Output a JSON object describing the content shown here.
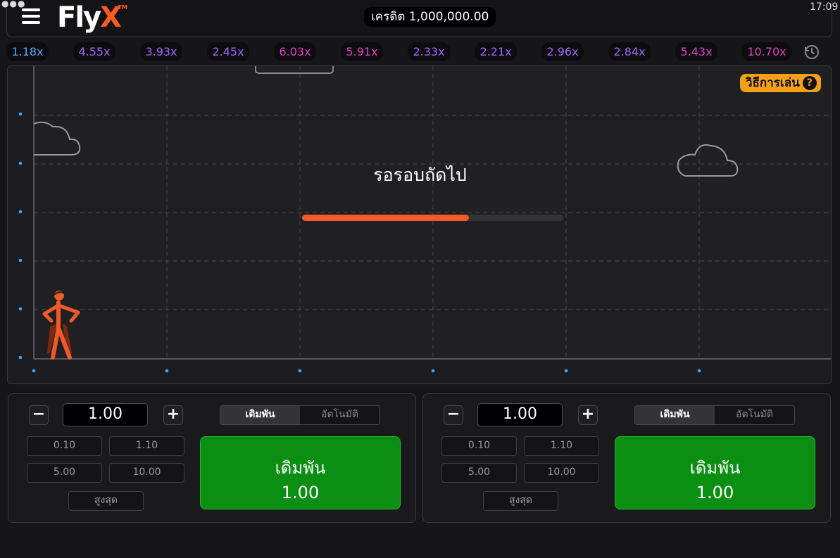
{
  "header": {
    "logo_main": "Fly",
    "logo_accent": "X",
    "logo_tm": "TM",
    "credit_label": "เครดิต 1,000,000.00",
    "clock": "17:09"
  },
  "history": {
    "items": [
      {
        "value": "1.18x",
        "color": "#4fa8ff"
      },
      {
        "value": "4.55x",
        "color": "#a066ff"
      },
      {
        "value": "3.93x",
        "color": "#a066ff"
      },
      {
        "value": "2.45x",
        "color": "#a066ff"
      },
      {
        "value": "6.03x",
        "color": "#e040c0"
      },
      {
        "value": "5.91x",
        "color": "#e040c0"
      },
      {
        "value": "2.33x",
        "color": "#a066ff"
      },
      {
        "value": "2.21x",
        "color": "#a066ff"
      },
      {
        "value": "2.96x",
        "color": "#a066ff"
      },
      {
        "value": "2.84x",
        "color": "#a066ff"
      },
      {
        "value": "5.43x",
        "color": "#e040c0"
      },
      {
        "value": "10.70x",
        "color": "#e040c0"
      }
    ]
  },
  "game": {
    "how_to_play": "วิธีการเล่น",
    "how_to_icon": "?",
    "status_text": "รอรอบถัดไป",
    "countdown_progress": 0.64,
    "progress_color": "#f05a28"
  },
  "panels": [
    {
      "amount": "1.00",
      "minus": "−",
      "plus": "+",
      "chips": [
        "0.10",
        "1.10",
        "5.00",
        "10.00"
      ],
      "max_label": "สูงสุด",
      "tab_bet": "เดิมพัน",
      "tab_auto": "อัตโนมัติ",
      "bet_button_label": "เดิมพัน",
      "bet_button_amount": "1.00"
    },
    {
      "amount": "1.00",
      "minus": "−",
      "plus": "+",
      "chips": [
        "0.10",
        "1.10",
        "5.00",
        "10.00"
      ],
      "max_label": "สูงสุด",
      "tab_bet": "เดิมพัน",
      "tab_auto": "อัตโนมัติ",
      "bet_button_label": "เดิมพัน",
      "bet_button_amount": "1.00"
    }
  ],
  "colors": {
    "accent": "#ff5a1f",
    "bet_green": "#0a8f12",
    "help_orange": "#f6a017",
    "axis_dot": "#3da5ff"
  }
}
